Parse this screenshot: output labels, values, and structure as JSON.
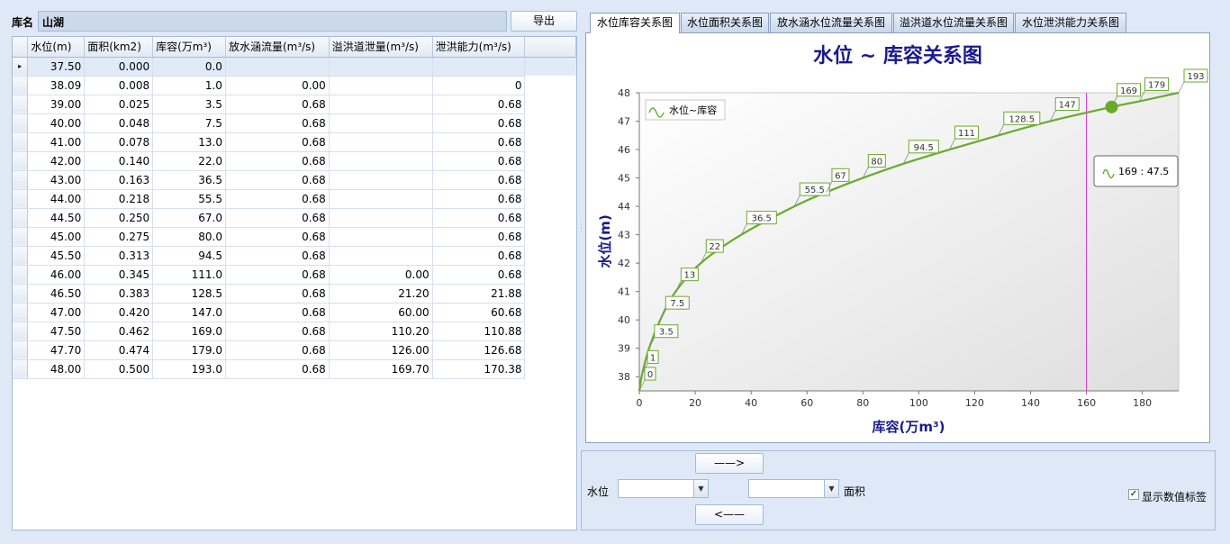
{
  "header": {
    "name_label": "库名",
    "name_value": "山湖",
    "export_label": "导出"
  },
  "table": {
    "columns": [
      "水位(m)",
      "面积(km2)",
      "库容(万m³)",
      "放水涵流量(m³/s)",
      "溢洪道泄量(m³/s)",
      "泄洪能力(m³/s)"
    ],
    "current_row_marker": "▸",
    "rows": [
      [
        "37.50",
        "0.000",
        "0.0",
        "",
        "",
        ""
      ],
      [
        "38.09",
        "0.008",
        "1.0",
        "0.00",
        "",
        "0"
      ],
      [
        "39.00",
        "0.025",
        "3.5",
        "0.68",
        "",
        "0.68"
      ],
      [
        "40.00",
        "0.048",
        "7.5",
        "0.68",
        "",
        "0.68"
      ],
      [
        "41.00",
        "0.078",
        "13.0",
        "0.68",
        "",
        "0.68"
      ],
      [
        "42.00",
        "0.140",
        "22.0",
        "0.68",
        "",
        "0.68"
      ],
      [
        "43.00",
        "0.163",
        "36.5",
        "0.68",
        "",
        "0.68"
      ],
      [
        "44.00",
        "0.218",
        "55.5",
        "0.68",
        "",
        "0.68"
      ],
      [
        "44.50",
        "0.250",
        "67.0",
        "0.68",
        "",
        "0.68"
      ],
      [
        "45.00",
        "0.275",
        "80.0",
        "0.68",
        "",
        "0.68"
      ],
      [
        "45.50",
        "0.313",
        "94.5",
        "0.68",
        "",
        "0.68"
      ],
      [
        "46.00",
        "0.345",
        "111.0",
        "0.68",
        "0.00",
        "0.68"
      ],
      [
        "46.50",
        "0.383",
        "128.5",
        "0.68",
        "21.20",
        "21.88"
      ],
      [
        "47.00",
        "0.420",
        "147.0",
        "0.68",
        "60.00",
        "60.68"
      ],
      [
        "47.50",
        "0.462",
        "169.0",
        "0.68",
        "110.20",
        "110.88"
      ],
      [
        "47.70",
        "0.474",
        "179.0",
        "0.68",
        "126.00",
        "126.68"
      ],
      [
        "48.00",
        "0.500",
        "193.0",
        "0.68",
        "169.70",
        "170.38"
      ]
    ]
  },
  "tabs": [
    {
      "label": "水位库容关系图",
      "active": true
    },
    {
      "label": "水位面积关系图",
      "active": false
    },
    {
      "label": "放水涵水位流量关系图",
      "active": false
    },
    {
      "label": "溢洪道水位流量关系图",
      "active": false
    },
    {
      "label": "水位泄洪能力关系图",
      "active": false
    }
  ],
  "chart_data": {
    "type": "line",
    "title": "水位 ~ 库容关系图",
    "xlabel": "库容(万m³)",
    "ylabel": "水位(m)",
    "xlim": [
      0,
      193
    ],
    "ylim": [
      37.5,
      48
    ],
    "xticks": [
      0,
      20,
      40,
      60,
      80,
      100,
      120,
      140,
      160,
      180
    ],
    "yticks": [
      38,
      39,
      40,
      41,
      42,
      43,
      44,
      45,
      46,
      47,
      48
    ],
    "grid": false,
    "legend_position": "top-left",
    "series": [
      {
        "name": "水位~库容",
        "color": "#6aaa2a",
        "x": [
          0,
          1,
          3.5,
          7.5,
          13,
          22,
          36.5,
          55.5,
          67,
          80,
          94.5,
          111,
          128.5,
          147,
          169,
          179,
          193
        ],
        "y": [
          37.5,
          38.09,
          39,
          40,
          41,
          42,
          43,
          44,
          44.5,
          45,
          45.5,
          46,
          46.5,
          47,
          47.5,
          47.7,
          48
        ],
        "point_labels": [
          "0",
          "1",
          "3.5",
          "7.5",
          "13",
          "22",
          "36.5",
          "55.5",
          "67",
          "80",
          "94.5",
          "111",
          "128.5",
          "147",
          "169",
          "179",
          "193"
        ]
      }
    ],
    "crosshair_x": 160,
    "crosshair_color": "#cc33cc",
    "highlight": {
      "x": 169,
      "y": 47.5,
      "tooltip": "169 : 47.5"
    }
  },
  "controls": {
    "forward_label": "——>",
    "back_label": "<——",
    "level_label": "水位",
    "level_value": "",
    "area_label": "面积",
    "area_value": "",
    "show_labels_text": "显示数值标签",
    "show_labels_checked": true,
    "dropdown_icon": "chevron-down-icon"
  }
}
